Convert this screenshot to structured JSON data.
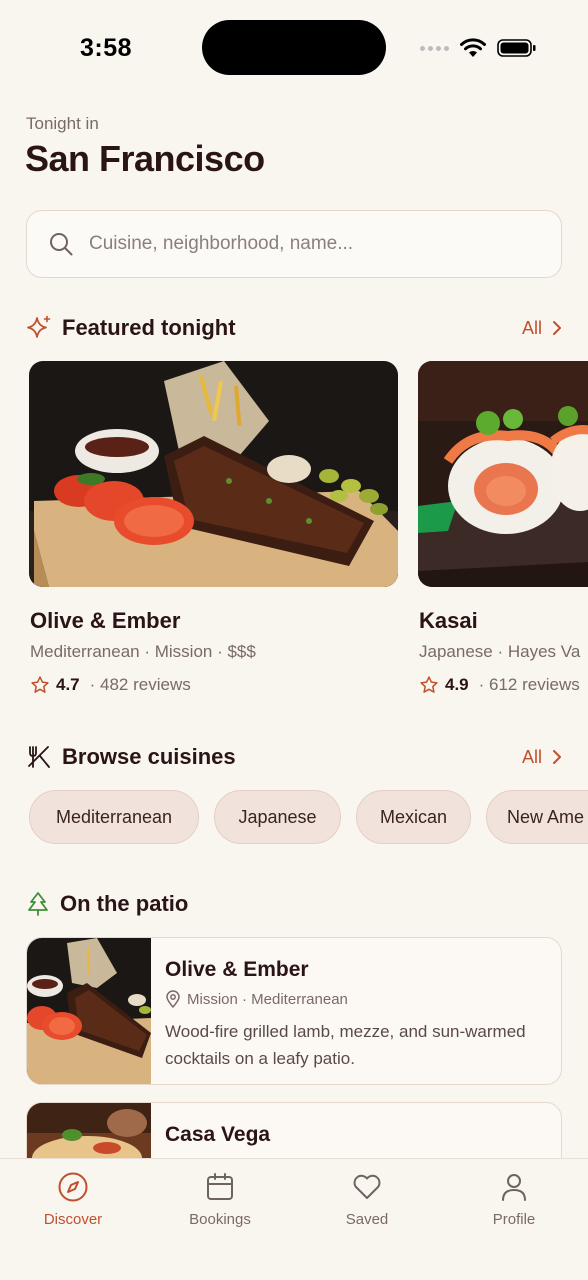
{
  "status_bar": {
    "time": "3:58"
  },
  "header": {
    "subtitle": "Tonight in",
    "city": "San Francisco"
  },
  "search": {
    "placeholder": "Cuisine, neighborhood, name..."
  },
  "featured": {
    "title": "Featured tonight",
    "all_label": "All",
    "cards": [
      {
        "name": "Olive & Ember",
        "meta": "Mediterranean · Mission · $$$",
        "rating": "4.7",
        "reviews": "· 482 reviews"
      },
      {
        "name": "Kasai",
        "meta": "Japanese · Hayes Va",
        "rating": "4.9",
        "reviews": "· 612 reviews"
      }
    ]
  },
  "cuisines": {
    "title": "Browse cuisines",
    "all_label": "All",
    "chips": [
      "Mediterranean",
      "Japanese",
      "Mexican",
      "New Ame"
    ]
  },
  "patio": {
    "title": "On the patio",
    "items": [
      {
        "name": "Olive & Ember",
        "location": "Mission · Mediterranean",
        "description": "Wood-fire grilled lamb, mezze, and sun-warmed cocktails on a leafy patio."
      },
      {
        "name": "Casa Vega",
        "location": "",
        "description": ""
      }
    ]
  },
  "tabs": [
    {
      "label": "Discover",
      "icon": "compass-icon",
      "active": true
    },
    {
      "label": "Bookings",
      "icon": "calendar-icon",
      "active": false
    },
    {
      "label": "Saved",
      "icon": "heart-icon",
      "active": false
    },
    {
      "label": "Profile",
      "icon": "person-icon",
      "active": false
    }
  ],
  "colors": {
    "accent": "#c0502e",
    "background": "#f9f5ef",
    "text": "#2a1414",
    "chip_bg": "#f1e3dc"
  }
}
